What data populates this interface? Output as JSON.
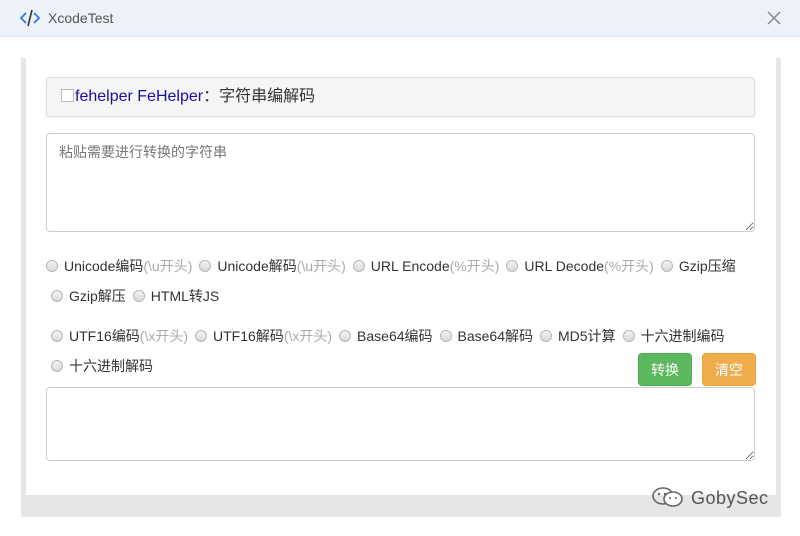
{
  "window": {
    "title": "XcodeTest",
    "close_icon": "close-icon"
  },
  "header": {
    "logo_alt": "fehelper",
    "brand": "FeHelper",
    "suffix": "：字符串编解码"
  },
  "input": {
    "placeholder": "粘贴需要进行转换的字符串",
    "value": ""
  },
  "options_row1": [
    {
      "label": "Unicode编码",
      "hint": "(\\u开头)"
    },
    {
      "label": "Unicode解码",
      "hint": "(\\u开头)"
    },
    {
      "label": "URL Encode",
      "hint": "(%开头)"
    },
    {
      "label": "URL Decode",
      "hint": "(%开头)"
    },
    {
      "label": "Gzip压缩",
      "hint": ""
    }
  ],
  "options_row2": [
    {
      "label": "Gzip解压",
      "hint": ""
    },
    {
      "label": "HTML转JS",
      "hint": ""
    }
  ],
  "options_row3": [
    {
      "label": "UTF16编码",
      "hint": "(\\x开头)"
    },
    {
      "label": "UTF16解码",
      "hint": "(\\x开头)"
    },
    {
      "label": "Base64编码",
      "hint": ""
    },
    {
      "label": "Base64解码",
      "hint": ""
    },
    {
      "label": "MD5计算",
      "hint": ""
    },
    {
      "label": "十六进制编码",
      "hint": ""
    }
  ],
  "options_row4": [
    {
      "label": "十六进制解码",
      "hint": ""
    }
  ],
  "buttons": {
    "convert": "转换",
    "clear": "清空"
  },
  "output": {
    "value": ""
  },
  "watermark": {
    "text": "GobySec"
  },
  "colors": {
    "convert": "#5cb85c",
    "clear": "#f0ad4e",
    "titlebar": "#edf1f9"
  }
}
